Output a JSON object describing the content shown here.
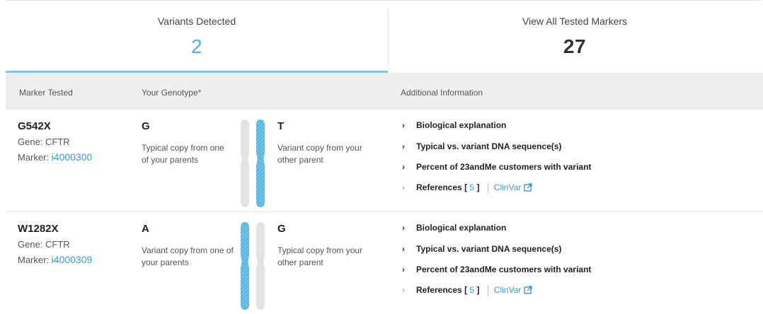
{
  "tabs": [
    {
      "label": "Variants Detected",
      "count": "2"
    },
    {
      "label": "View All Tested Markers",
      "count": "27"
    }
  ],
  "table_header": {
    "marker": "Marker Tested",
    "genotype": "Your Genotype*",
    "additional": "Additional Information"
  },
  "rows": [
    {
      "name": "G542X",
      "gene": "Gene: CFTR",
      "marker_label": "Marker: ",
      "marker_id": "i4000300",
      "allele1": "G",
      "allele1_desc": "Typical copy from one of your parents",
      "allele2": "T",
      "allele2_desc": "Variant copy from your other parent",
      "links": [
        "Biological explanation",
        "Typical vs. variant DNA sequence(s)",
        "Percent of 23andMe customers with variant"
      ],
      "references_label": "References",
      "references_open": "[",
      "references_count": "5",
      "references_close": "]",
      "clinvar": "ClinVar"
    },
    {
      "name": "W1282X",
      "gene": "Gene: CFTR",
      "marker_label": "Marker: ",
      "marker_id": "i4000309",
      "allele1": "A",
      "allele1_desc": "Variant copy from one of your parents",
      "allele2": "G",
      "allele2_desc": "Typical copy from your other parent",
      "links": [
        "Biological explanation",
        "Typical vs. variant DNA sequence(s)",
        "Percent of 23andMe customers with variant"
      ],
      "references_label": "References",
      "references_open": "[",
      "references_count": "5",
      "references_close": "]",
      "clinvar": "ClinVar"
    }
  ],
  "icons": {
    "chevron": "chevron-right-icon",
    "external": "external-link-icon",
    "chromosome": "chromosome-pair-icon"
  },
  "colors": {
    "accent": "#4ab4e4",
    "link": "#3a9bd9",
    "chromosome_variant": "#5ab8e2",
    "chromosome_typical": "#e3e3e3"
  }
}
